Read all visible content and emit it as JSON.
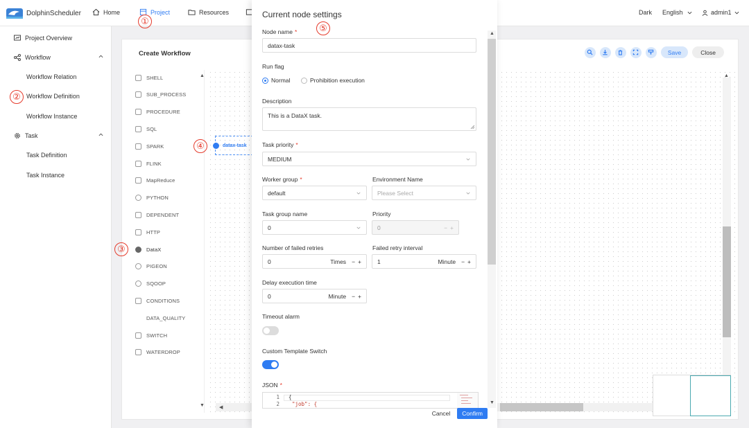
{
  "app": {
    "name": "DolphinScheduler"
  },
  "topnav": {
    "items": [
      {
        "label": "Home",
        "icon": "home-icon"
      },
      {
        "label": "Project",
        "icon": "project-icon",
        "active": true
      },
      {
        "label": "Resources",
        "icon": "folder-icon"
      }
    ],
    "theme": "Dark",
    "language": "English",
    "user": "admin1"
  },
  "sidebar": {
    "items": [
      {
        "label": "Project Overview",
        "icon": "overview-icon"
      },
      {
        "label": "Workflow",
        "icon": "workflow-icon",
        "expanded": true
      },
      {
        "label": "Workflow Relation"
      },
      {
        "label": "Workflow Definition"
      },
      {
        "label": "Workflow Instance"
      },
      {
        "label": "Task",
        "icon": "gear-icon",
        "expanded": true
      },
      {
        "label": "Task Definition"
      },
      {
        "label": "Task Instance"
      }
    ]
  },
  "workflow": {
    "title": "Create Workflow",
    "save_label": "Save",
    "close_label": "Close",
    "toolbox": [
      "SHELL",
      "SUB_PROCESS",
      "PROCEDURE",
      "SQL",
      "SPARK",
      "FLINK",
      "MapReduce",
      "PYTHON",
      "DEPENDENT",
      "HTTP",
      "DataX",
      "PIGEON",
      "SQOOP",
      "CONDITIONS",
      "DATA_QUALITY",
      "SWITCH",
      "WATERDROP"
    ],
    "node_label": "datax-task"
  },
  "annotations": [
    "①",
    "②",
    "③",
    "④",
    "⑤"
  ],
  "drawer": {
    "title": "Current node settings",
    "node_name": {
      "label": "Node name",
      "value": "datax-task"
    },
    "run_flag": {
      "label": "Run flag",
      "options": [
        "Normal",
        "Prohibition execution"
      ],
      "selected": "Normal"
    },
    "description": {
      "label": "Description",
      "value": "This is a DataX task."
    },
    "task_priority": {
      "label": "Task priority",
      "value": "MEDIUM"
    },
    "worker_group": {
      "label": "Worker group",
      "value": "default"
    },
    "environment_name": {
      "label": "Environment Name",
      "placeholder": "Please Select"
    },
    "task_group_name": {
      "label": "Task group name",
      "value": "0"
    },
    "priority": {
      "label": "Priority",
      "value": "0"
    },
    "failed_retries": {
      "label": "Number of failed retries",
      "value": "0",
      "unit": "Times"
    },
    "retry_interval": {
      "label": "Failed retry interval",
      "value": "1",
      "unit": "Minute"
    },
    "delay_time": {
      "label": "Delay execution time",
      "value": "0",
      "unit": "Minute"
    },
    "timeout_alarm": {
      "label": "Timeout alarm",
      "on": false
    },
    "custom_template": {
      "label": "Custom Template Switch",
      "on": true
    },
    "json": {
      "label": "JSON",
      "lines": [
        "{",
        "\"job\": {"
      ],
      "line_numbers": [
        "1",
        "2"
      ]
    },
    "stepper_minus": "−",
    "stepper_plus": "+",
    "cancel_label": "Cancel",
    "confirm_label": "Confirm"
  },
  "colors": {
    "accent": "#2f7cf2",
    "annotation": "#e53b2c"
  }
}
